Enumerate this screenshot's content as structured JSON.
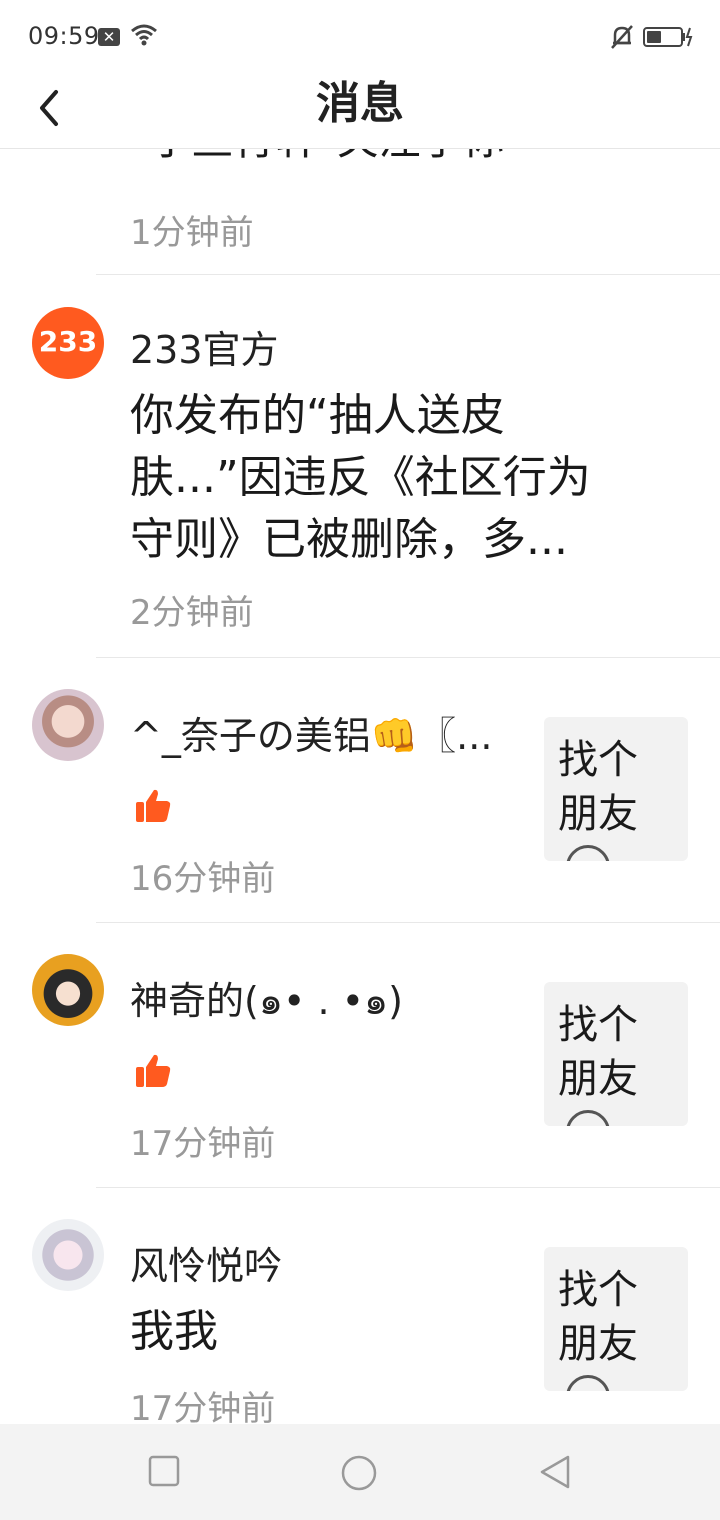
{
  "status_bar": {
    "time": "09:59"
  },
  "header": {
    "title": "消息"
  },
  "messages": [
    {
      "body": "\"小鱼行轩\"关注了你",
      "time": "1分钟前"
    },
    {
      "name": "233官方",
      "avatar_text": "233",
      "body_lines": [
        "你发布的“抽人送皮",
        "肤...”因违反《社区行为",
        "守则》已被删除，多..."
      ],
      "time": "2分钟前"
    },
    {
      "name": "^_奈子の美铝👊〖...",
      "time": "16分钟前",
      "preview": "找个朋友"
    },
    {
      "name": "神奇的(๑• . •๑)",
      "time": "17分钟前",
      "preview": "找个朋友"
    },
    {
      "name": "风怜悦吟",
      "body": "我我",
      "time": "17分钟前",
      "preview": "找个朋友"
    }
  ],
  "colors": {
    "accent": "#ff5a1f",
    "time_gray": "#999999"
  },
  "nav": {
    "icons": [
      "recents-square-icon",
      "home-circle-icon",
      "back-triangle-icon"
    ]
  }
}
